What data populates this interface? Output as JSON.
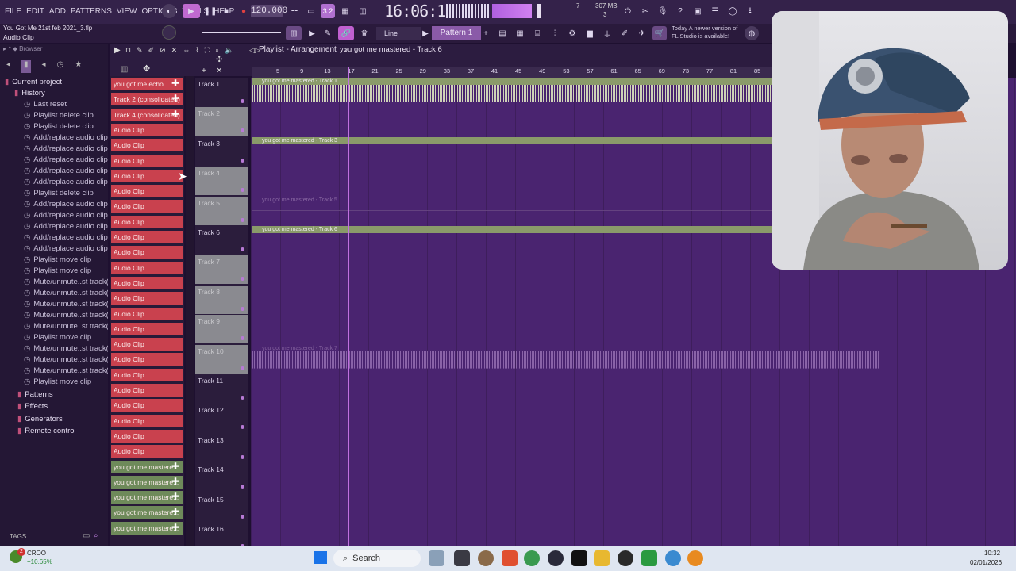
{
  "menu": [
    "FILE",
    "EDIT",
    "ADD",
    "PATTERNS",
    "VIEW",
    "OPTIONS",
    "TOOLS",
    "HELP"
  ],
  "transport": {
    "tempo": "120.000",
    "time": "16:06:16",
    "cpu": "7",
    "memory": "307 MB",
    "voices": "3",
    "pattern": "Pattern 1",
    "snap": "Line"
  },
  "hint": {
    "title": "You Got Me 21st feb 2021_3.flp",
    "sub": "Audio Clip"
  },
  "notice": {
    "line1": "Today  A newer version of",
    "line2": "FL Studio is available!"
  },
  "browser": {
    "label": "Browser",
    "project": "Current project",
    "history": "History",
    "history_items": [
      "Last reset",
      "Playlist delete clip",
      "Playlist delete clip",
      "Add/replace audio clip",
      "Add/replace audio clip",
      "Add/replace audio clip",
      "Add/replace audio clip",
      "Add/replace audio clip",
      "Playlist delete clip",
      "Add/replace audio clip",
      "Add/replace audio clip",
      "Add/replace audio clip",
      "Add/replace audio clip",
      "Add/replace audio clip",
      "Playlist move clip",
      "Playlist move clip",
      "Mute/unmute..st track(s)",
      "Mute/unmute..st track(s)",
      "Mute/unmute..st track(s)",
      "Mute/unmute..st track(s)",
      "Mute/unmute..st track(s)",
      "Playlist move clip",
      "Mute/unmute..st track(s)",
      "Mute/unmute..st track(s)",
      "Mute/unmute..st track(s)",
      "Playlist move clip"
    ],
    "sections": [
      "Patterns",
      "Effects",
      "Generators",
      "Remote control"
    ],
    "tags": "TAGS"
  },
  "playlist": {
    "title": "Playlist - Arrangement",
    "track": "you got me mastered - Track 6",
    "ruler": [
      "5",
      "9",
      "13",
      "17",
      "21",
      "25",
      "29",
      "33",
      "37",
      "41",
      "45",
      "49",
      "53",
      "57",
      "61",
      "65",
      "69",
      "73",
      "77",
      "81",
      "85"
    ],
    "playhead_bar": 17
  },
  "clips": [
    {
      "label": "you got me echo",
      "color": "red",
      "plus": true
    },
    {
      "label": "Track 2 (consolidated)",
      "color": "red",
      "plus": true
    },
    {
      "label": "Track 4 (consolidated)",
      "color": "red",
      "plus": true
    },
    {
      "label": "Audio Clip",
      "color": "red"
    },
    {
      "label": "Audio Clip",
      "color": "red"
    },
    {
      "label": "Audio Clip",
      "color": "red"
    },
    {
      "label": "Audio Clip",
      "color": "red"
    },
    {
      "label": "Audio Clip",
      "color": "red"
    },
    {
      "label": "Audio Clip",
      "color": "red"
    },
    {
      "label": "Audio Clip",
      "color": "red"
    },
    {
      "label": "Audio Clip",
      "color": "red"
    },
    {
      "label": "Audio Clip",
      "color": "red"
    },
    {
      "label": "Audio Clip",
      "color": "red"
    },
    {
      "label": "Audio Clip",
      "color": "red"
    },
    {
      "label": "Audio Clip",
      "color": "red"
    },
    {
      "label": "Audio Clip",
      "color": "red"
    },
    {
      "label": "Audio Clip",
      "color": "red"
    },
    {
      "label": "Audio Clip",
      "color": "red"
    },
    {
      "label": "Audio Clip",
      "color": "red"
    },
    {
      "label": "Audio Clip",
      "color": "red"
    },
    {
      "label": "Audio Clip",
      "color": "red"
    },
    {
      "label": "Audio Clip",
      "color": "red"
    },
    {
      "label": "Audio Clip",
      "color": "red"
    },
    {
      "label": "Audio Clip",
      "color": "red"
    },
    {
      "label": "Audio Clip",
      "color": "red"
    },
    {
      "label": "you got me mastere...",
      "color": "green",
      "plus": true
    },
    {
      "label": "you got me mastere...",
      "color": "green",
      "plus": true
    },
    {
      "label": "you got me mastere...",
      "color": "green",
      "plus": true
    },
    {
      "label": "you got me mastere...",
      "color": "green",
      "plus": true
    },
    {
      "label": "you got me mastere...",
      "color": "green",
      "plus": true
    }
  ],
  "tracks": [
    {
      "name": "Track 1",
      "muted": false
    },
    {
      "name": "Track 2",
      "muted": true
    },
    {
      "name": "Track 3",
      "muted": false
    },
    {
      "name": "Track 4",
      "muted": true
    },
    {
      "name": "Track 5",
      "muted": true
    },
    {
      "name": "Track 6",
      "muted": false
    },
    {
      "name": "Track 7",
      "muted": true
    },
    {
      "name": "Track 8",
      "muted": true
    },
    {
      "name": "Track 9",
      "muted": true
    },
    {
      "name": "Track 10",
      "muted": true
    },
    {
      "name": "Track 11",
      "muted": false
    },
    {
      "name": "Track 12",
      "muted": false
    },
    {
      "name": "Track 13",
      "muted": false
    },
    {
      "name": "Track 14",
      "muted": false
    },
    {
      "name": "Track 15",
      "muted": false
    },
    {
      "name": "Track 16",
      "muted": false
    }
  ],
  "lanes": [
    {
      "track": 1,
      "title": "you got me mastered - Track 1",
      "style": "wave",
      "color": "#cfd2b8"
    },
    {
      "track": 3,
      "title": "you got me mastered - Track 3",
      "style": "flat",
      "color": "#8a9a6a"
    },
    {
      "track": 5,
      "title": "you got me mastered - Track 5",
      "style": "ghost",
      "color": "#6a4a84"
    },
    {
      "track": 6,
      "title": "you got me mastered - Track 6",
      "style": "flat",
      "color": "#8a9a6a"
    },
    {
      "track": 10,
      "title": "you got me mastered - Track 7",
      "style": "wave",
      "color": "#a57ec0"
    }
  ],
  "taskbar": {
    "ticker": "CROO",
    "change": "+10.65%",
    "search": "Search",
    "time": "10:32",
    "date": "02/01/2026",
    "badge": "2"
  }
}
